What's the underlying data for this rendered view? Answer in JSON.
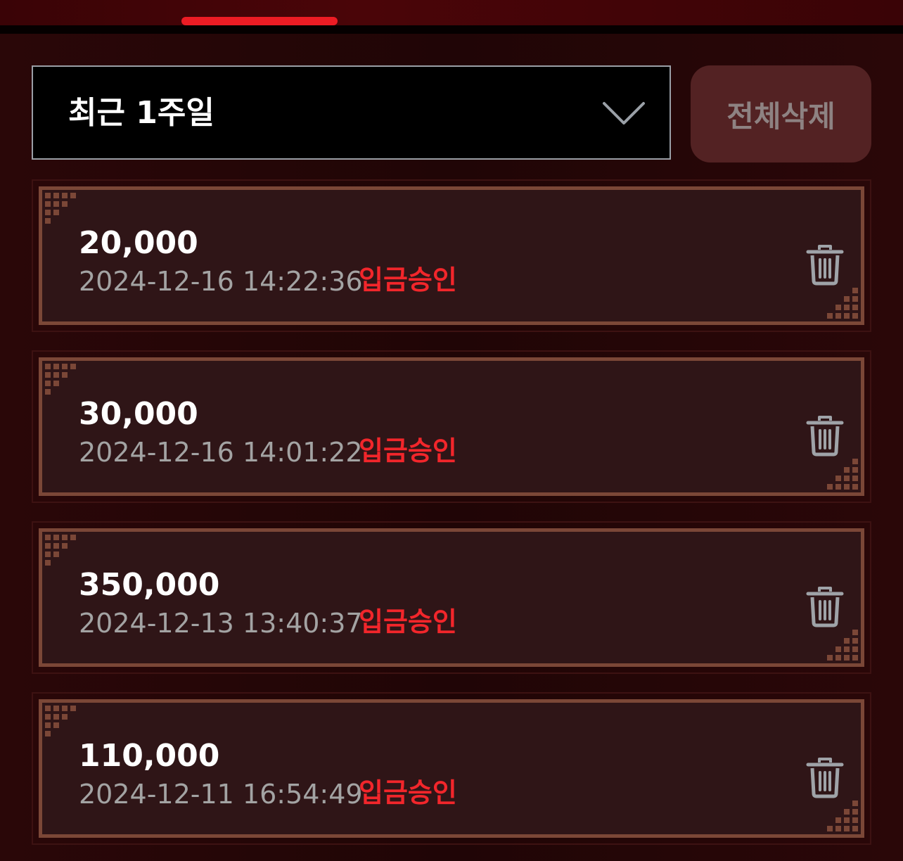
{
  "filter": {
    "selected": "최근 1주일"
  },
  "actions": {
    "delete_all_label": "전체삭제"
  },
  "records": [
    {
      "amount": "20,000",
      "datetime": "2024-12-16 14:22:36",
      "status": "입금승인"
    },
    {
      "amount": "30,000",
      "datetime": "2024-12-16 14:01:22",
      "status": "입금승인"
    },
    {
      "amount": "350,000",
      "datetime": "2024-12-13 13:40:37",
      "status": "입금승인"
    },
    {
      "amount": "110,000",
      "datetime": "2024-12-11 16:54:49",
      "status": "입금승인"
    }
  ],
  "icons": {
    "dropdown": "chevron-down-icon",
    "delete": "trash-icon"
  },
  "colors": {
    "accent": "#ec1c24",
    "status": "#f2262b",
    "card_bg": "#2f1517",
    "card_border": "#7b4737",
    "button_bg": "#532223"
  }
}
